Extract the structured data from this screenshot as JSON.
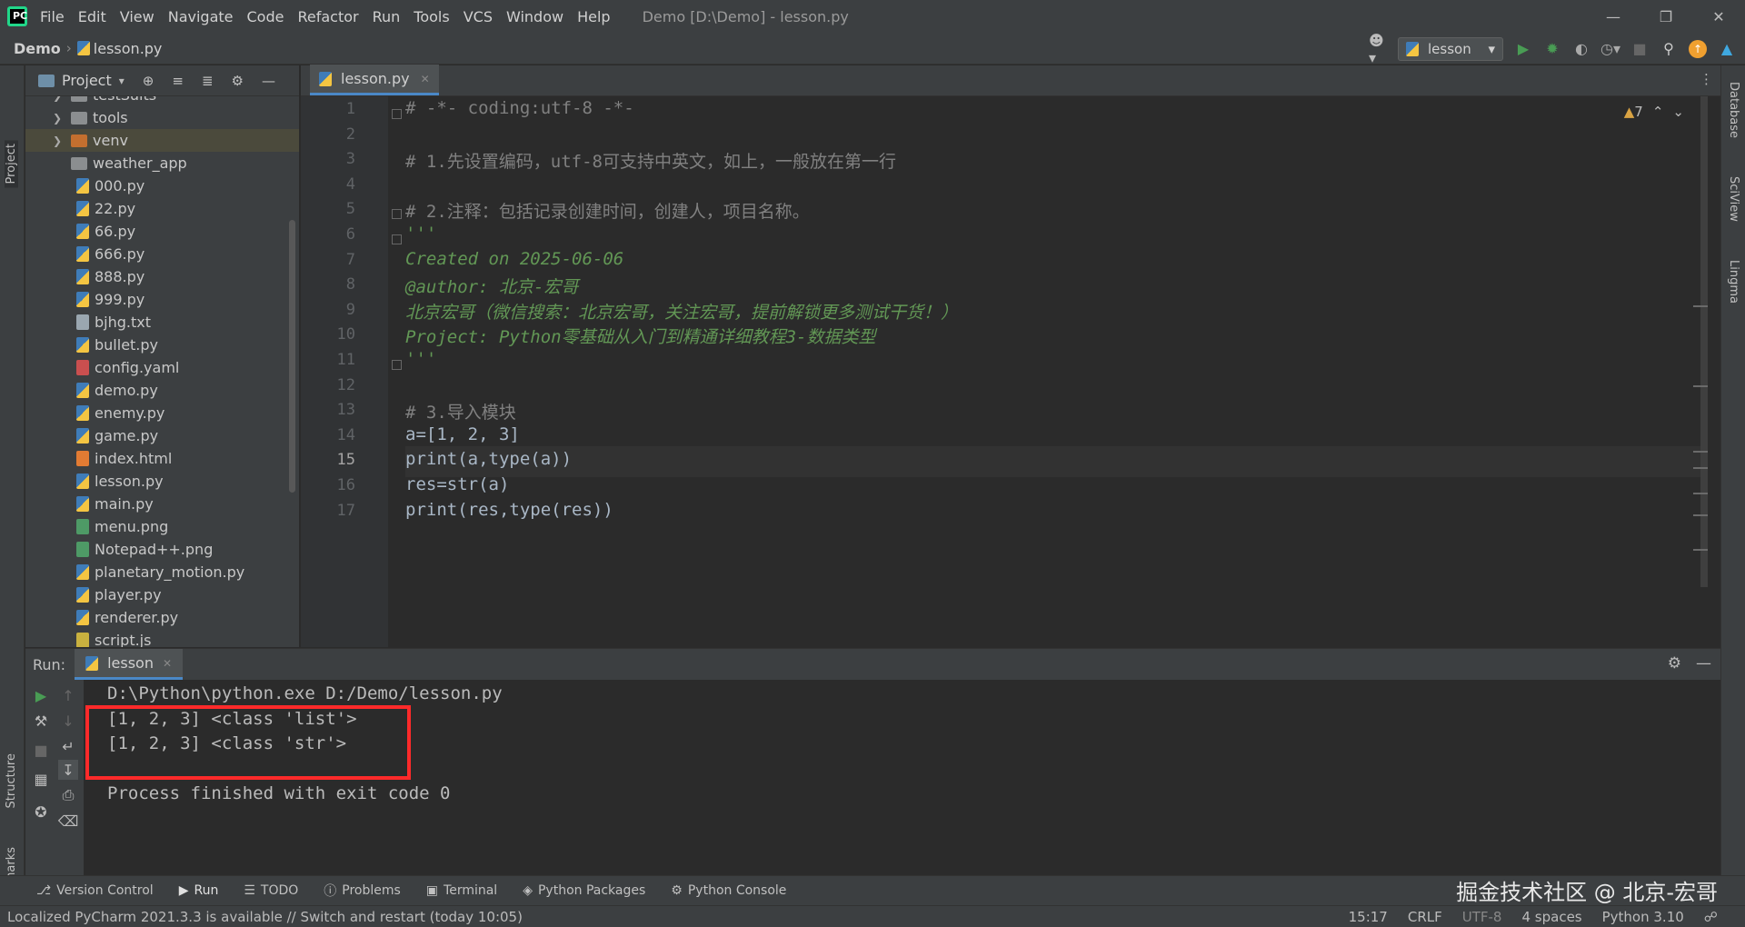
{
  "titlebar": {
    "menu": [
      "File",
      "Edit",
      "View",
      "Navigate",
      "Code",
      "Refactor",
      "Run",
      "Tools",
      "VCS",
      "Window",
      "Help"
    ],
    "window_title": "Demo [D:\\Demo] - lesson.py"
  },
  "navbar": {
    "root": "Demo",
    "file": "lesson.py",
    "run_config": "lesson"
  },
  "left_strip": {
    "project": "Project",
    "structure": "Structure",
    "bookmarks": "Bookmarks"
  },
  "right_strip": {
    "database": "Database",
    "sciview": "SciView",
    "lingma": "Lingma"
  },
  "project_panel": {
    "title": "Project",
    "tree": [
      {
        "name": "testSuits",
        "type": "folder"
      },
      {
        "name": "tools",
        "type": "folder"
      },
      {
        "name": "venv",
        "type": "folder-orange"
      },
      {
        "name": "weather_app",
        "type": "folder-leaf"
      },
      {
        "name": "000.py",
        "type": "py"
      },
      {
        "name": "22.py",
        "type": "py"
      },
      {
        "name": "66.py",
        "type": "py"
      },
      {
        "name": "666.py",
        "type": "py"
      },
      {
        "name": "888.py",
        "type": "py"
      },
      {
        "name": "999.py",
        "type": "py"
      },
      {
        "name": "bjhg.txt",
        "type": "txt"
      },
      {
        "name": "bullet.py",
        "type": "py"
      },
      {
        "name": "config.yaml",
        "type": "yaml"
      },
      {
        "name": "demo.py",
        "type": "py"
      },
      {
        "name": "enemy.py",
        "type": "py"
      },
      {
        "name": "game.py",
        "type": "py"
      },
      {
        "name": "index.html",
        "type": "html"
      },
      {
        "name": "lesson.py",
        "type": "py"
      },
      {
        "name": "main.py",
        "type": "py"
      },
      {
        "name": "menu.png",
        "type": "png"
      },
      {
        "name": "Notepad++.png",
        "type": "png"
      },
      {
        "name": "planetary_motion.py",
        "type": "py"
      },
      {
        "name": "player.py",
        "type": "py"
      },
      {
        "name": "renderer.py",
        "type": "py"
      },
      {
        "name": "script.js",
        "type": "js"
      }
    ]
  },
  "editor": {
    "tab": "lesson.py",
    "inspection_count": "7",
    "current_line": 15,
    "lines": [
      {
        "n": "1",
        "text": "# -*- coding:utf-8 -*-",
        "cls": "c-comment"
      },
      {
        "n": "2",
        "text": "",
        "cls": "c-plain"
      },
      {
        "n": "3",
        "text": "# 1.先设置编码，utf-8可支持中英文，如上，一般放在第一行",
        "cls": "c-comment"
      },
      {
        "n": "4",
        "text": "",
        "cls": "c-plain"
      },
      {
        "n": "5",
        "text": "# 2.注释：包括记录创建时间，创建人，项目名称。",
        "cls": "c-comment"
      },
      {
        "n": "6",
        "text": "'''",
        "cls": "c-doc"
      },
      {
        "n": "7",
        "text": "Created on 2025-06-06",
        "cls": "c-doc"
      },
      {
        "n": "8",
        "text": "@author: 北京-宏哥",
        "cls": "c-doc"
      },
      {
        "n": "9",
        "text": "北京宏哥（微信搜索：北京宏哥，关注宏哥，提前解锁更多测试干货！）",
        "cls": "c-doc"
      },
      {
        "n": "10",
        "text": "Project: Python零基础从入门到精通详细教程3-数据类型",
        "cls": "c-doc"
      },
      {
        "n": "11",
        "text": "'''",
        "cls": "c-doc"
      },
      {
        "n": "12",
        "text": "",
        "cls": "c-plain"
      },
      {
        "n": "13",
        "text": "# 3.导入模块",
        "cls": "c-comment"
      },
      {
        "n": "14",
        "text": "a=[1, 2, 3]",
        "cls": "c-plain"
      },
      {
        "n": "15",
        "text": "print(a,type(a))",
        "cls": "c-plain"
      },
      {
        "n": "16",
        "text": "res=str(a)",
        "cls": "c-plain"
      },
      {
        "n": "17",
        "text": "print(res,type(res))",
        "cls": "c-plain"
      }
    ]
  },
  "run_panel": {
    "label": "Run:",
    "tab": "lesson",
    "console": [
      "D:\\Python\\python.exe D:/Demo/lesson.py",
      "[1, 2, 3] <class 'list'>",
      "[1, 2, 3] <class 'str'>",
      "",
      "Process finished with exit code 0"
    ]
  },
  "tool_windows": [
    "Version Control",
    "Run",
    "TODO",
    "Problems",
    "Terminal",
    "Python Packages",
    "Python Console"
  ],
  "watermark": "掘金技术社区 @ 北京-宏哥",
  "statusbar": {
    "message": "Localized PyCharm 2021.3.3 is available // Switch and restart (today 10:05)",
    "position": "15:17",
    "line_sep": "CRLF",
    "encoding": "UTF-8",
    "indent": "4 spaces",
    "interpreter": "Python 3.10"
  },
  "colors": {
    "accent": "#4a88c7",
    "highlight_box": "#ff2a2a",
    "run_green": "#499c54"
  }
}
